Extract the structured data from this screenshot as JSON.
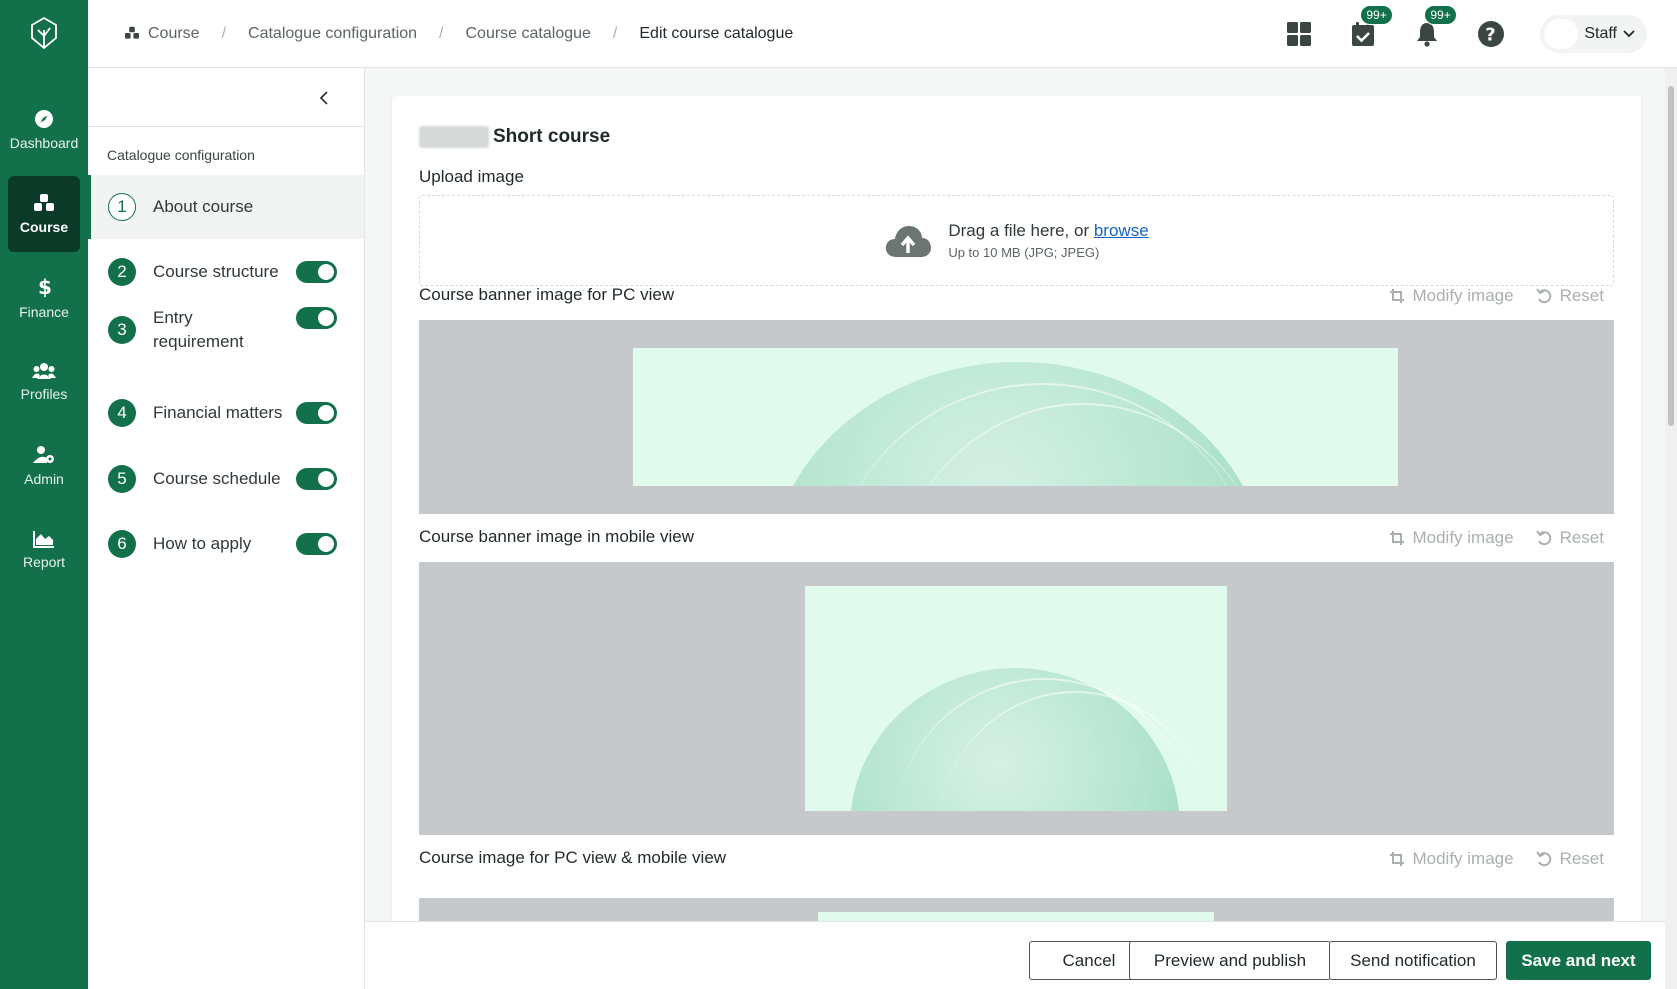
{
  "rail": {
    "items": [
      {
        "label": "Dashboard",
        "icon": "compass-icon"
      },
      {
        "label": "Course",
        "icon": "cubes-icon",
        "active": true
      },
      {
        "label": "Finance",
        "icon": "dollar-icon"
      },
      {
        "label": "Profiles",
        "icon": "users-icon"
      },
      {
        "label": "Admin",
        "icon": "user-gear-icon"
      },
      {
        "label": "Report",
        "icon": "chart-area-icon"
      }
    ]
  },
  "breadcrumb": {
    "items": [
      "Course",
      "Catalogue configuration",
      "Course catalogue",
      "Edit course catalogue"
    ],
    "separator": "/"
  },
  "header": {
    "tasks_badge": "99+",
    "notifications_badge": "99+",
    "user_label": "Staff"
  },
  "steps": {
    "title": "Catalogue configuration",
    "items": [
      {
        "num": "1",
        "label": "About course",
        "active": true,
        "toggle": null
      },
      {
        "num": "2",
        "label": "Course structure",
        "toggle": "on"
      },
      {
        "num": "3",
        "label": "Entry requirement",
        "toggle": "on"
      },
      {
        "num": "4",
        "label": "Financial matters",
        "toggle": "on"
      },
      {
        "num": "5",
        "label": "Course schedule",
        "toggle": "on"
      },
      {
        "num": "6",
        "label": "How to apply",
        "toggle": "on"
      }
    ]
  },
  "main": {
    "course_title": "Short course",
    "upload_label": "Upload image",
    "upload_text": "Drag a file here, or ",
    "upload_link": "browse",
    "upload_hint": "Up to 10 MB (JPG; JPEG)",
    "sections": [
      {
        "label": "Course banner image for PC view"
      },
      {
        "label": "Course banner image in mobile view"
      },
      {
        "label": "Course image for PC view & mobile view"
      }
    ],
    "modify_label": "Modify image",
    "reset_label": "Reset"
  },
  "footer": {
    "cancel": "Cancel",
    "preview": "Preview and publish",
    "notify": "Send notification",
    "save": "Save and next"
  },
  "colors": {
    "brand": "#12704a",
    "rail_active": "#0b3a28",
    "link": "#1565c0"
  }
}
